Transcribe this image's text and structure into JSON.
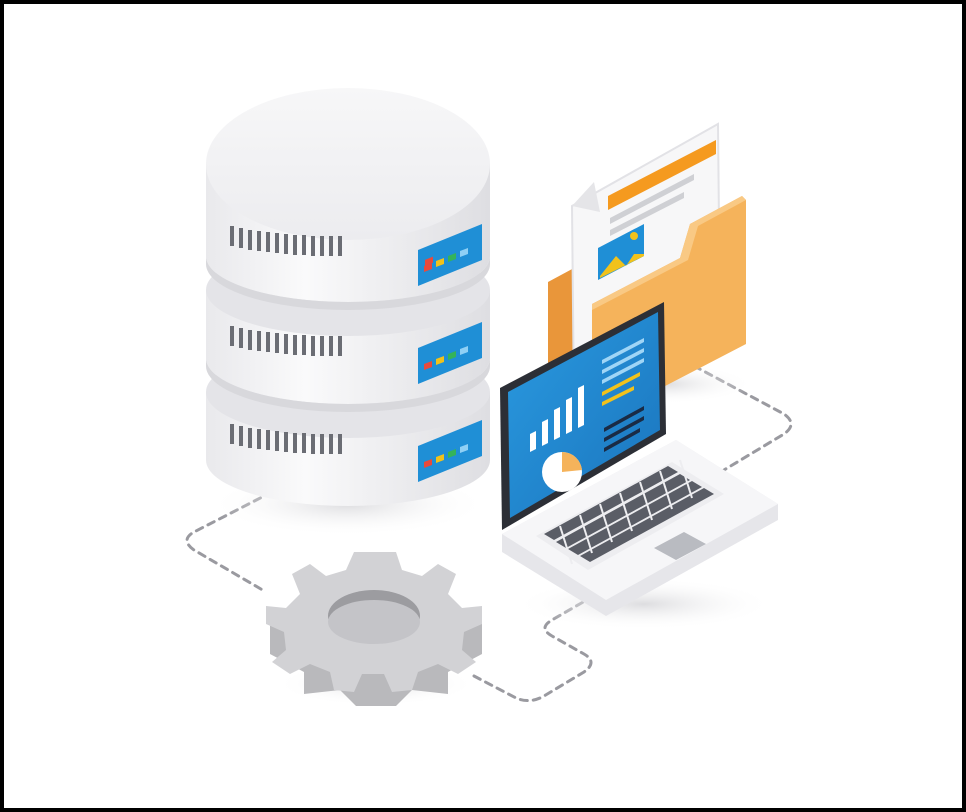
{
  "scene": {
    "frame_color": "#000000",
    "background_color": "#ffffff",
    "icons": [
      "database-server-icon",
      "document-folder-icon",
      "laptop-dashboard-icon",
      "gear-icon",
      "dashed-connector-lines"
    ],
    "colors": {
      "server_white": "#f4f4f6",
      "server_shade": "#dcdce0",
      "panel_blue": "#1f8fd6",
      "folder_orange": "#f5b35b",
      "folder_dark": "#e9963a",
      "document_accent": "#f59a1f",
      "screen_blue": "#1e88d0",
      "keyboard_grey": "#5a5d66",
      "gear_grey": "#c9c9cc",
      "dash_grey": "#9a9aa0",
      "led_red": "#e84a3c",
      "led_yellow": "#f1c21b",
      "led_green": "#34b35a"
    }
  }
}
